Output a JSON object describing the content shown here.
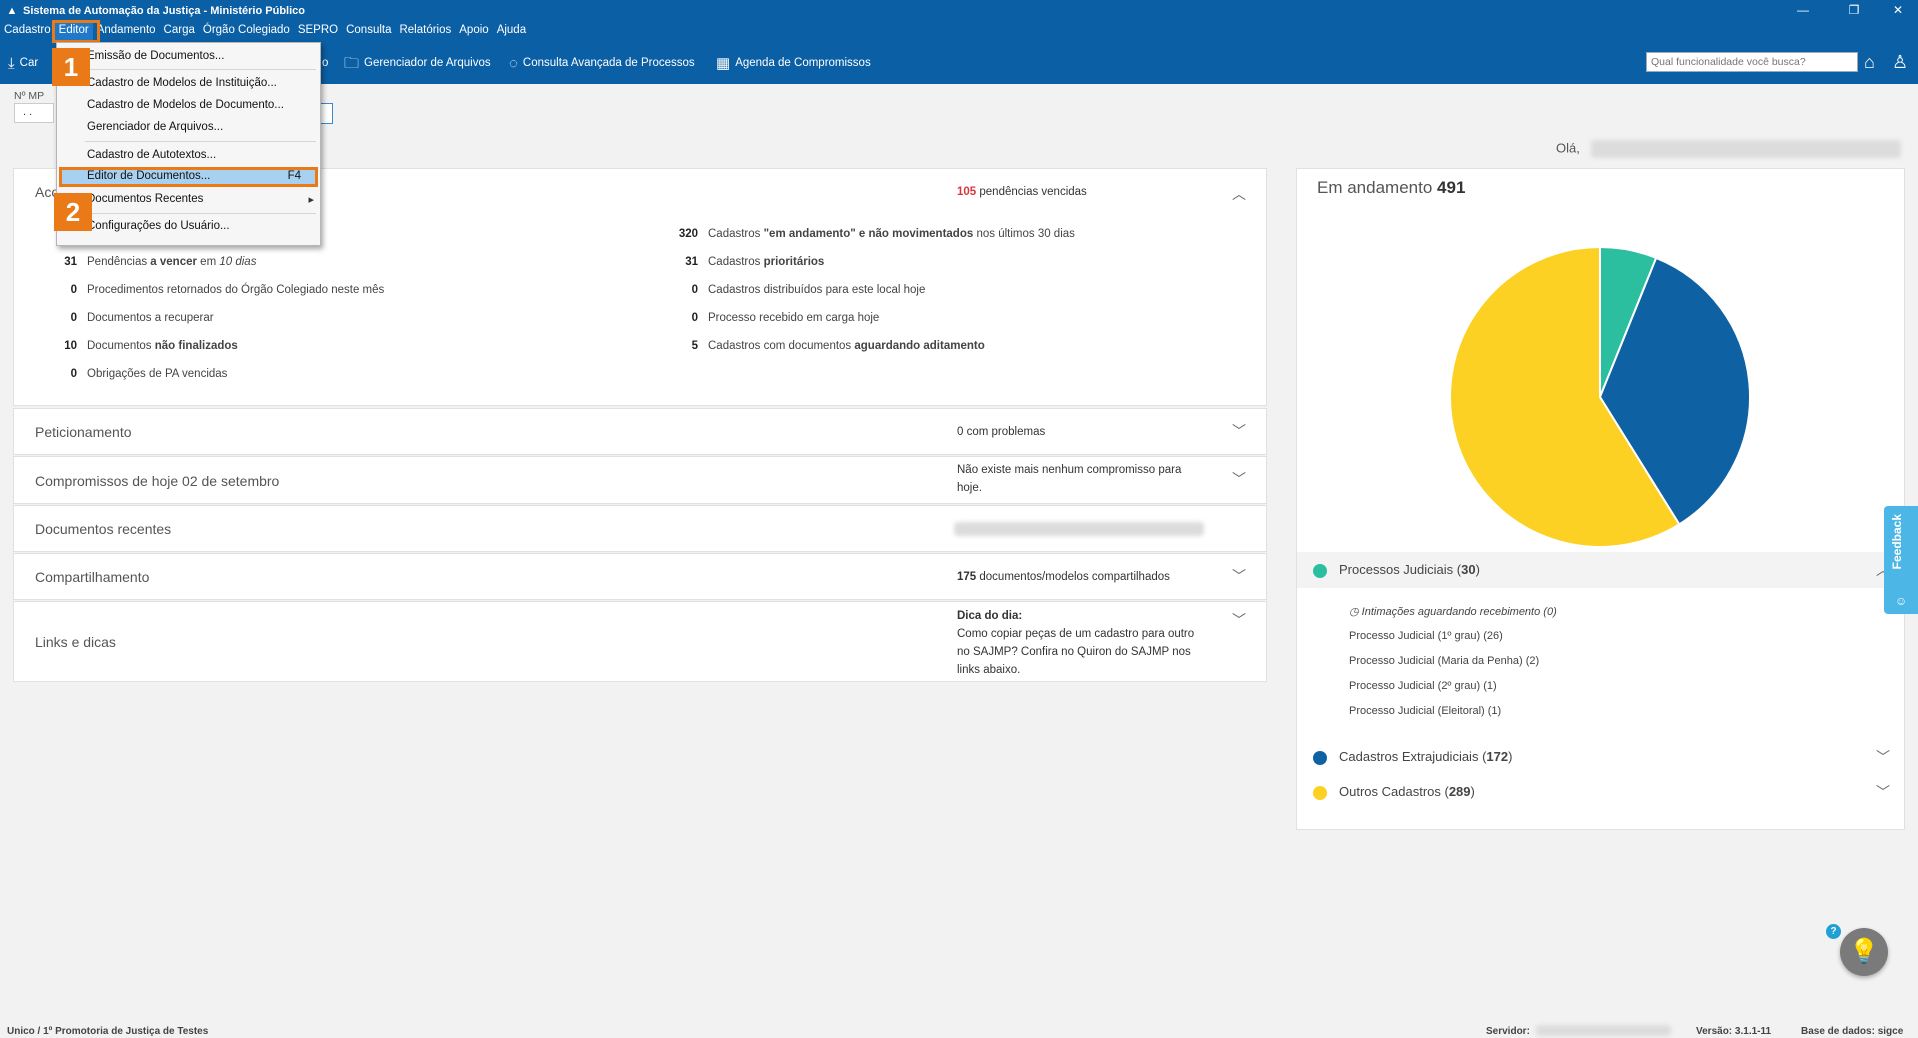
{
  "window": {
    "title": "Sistema de Automação da Justiça - Ministério Público"
  },
  "menubar": [
    "Cadastro",
    "Editor",
    "Andamento",
    "Carga",
    "Órgão Colegiado",
    "SEPRO",
    "Consulta",
    "Relatórios",
    "Apoio",
    "Ajuda"
  ],
  "toolbar": {
    "carga_label": "Car",
    "partial_label": "o",
    "gerenciador": "Gerenciador de Arquivos",
    "consulta": "Consulta Avançada de Processos",
    "agenda": "Agenda de Compromissos",
    "search_placeholder": "Qual funcionalidade você busca?"
  },
  "mp_field": {
    "label": "Nº MP",
    "value": ". ."
  },
  "greeting": "Olá,",
  "editor_menu": {
    "items": [
      "Emissão de Documentos...",
      "Cadastro de Modelos de Instituição...",
      "Cadastro de Modelos de Documento...",
      "Gerenciador de Arquivos...",
      "Cadastro de Autotextos...",
      "Editor de Documentos...",
      "Documentos Recentes",
      "Configurações do Usuário..."
    ],
    "shortcut": "F4",
    "submenu_arrow": "▸"
  },
  "annotations": {
    "step1": "1",
    "step2": "2"
  },
  "acompanhamento": {
    "title": "Acompanhamento",
    "right_num": "105",
    "right_text": "pendências vencidas",
    "left_stats": [
      {
        "num": "31",
        "pre": "Pendências ",
        "bold": "a vencer",
        "post": " em ",
        "italic": "10 dias"
      },
      {
        "num": "0",
        "text": "Procedimentos retornados do Órgão Colegiado neste mês"
      },
      {
        "num": "0",
        "text": "Documentos a recuperar"
      },
      {
        "num": "10",
        "pre": "Documentos ",
        "bold": "não finalizados"
      },
      {
        "num": "0",
        "text": "Obrigações de PA vencidas"
      }
    ],
    "right_stats": [
      {
        "num": "320",
        "pre": "Cadastros ",
        "bold": "\"em andamento\" e não movimentados",
        "post": " nos últimos 30 dias"
      },
      {
        "num": "31",
        "pre": "Cadastros ",
        "bold": "prioritários"
      },
      {
        "num": "0",
        "text": "Cadastros distribuídos para este local hoje"
      },
      {
        "num": "0",
        "text": "Processo recebido em carga hoje"
      },
      {
        "num": "5",
        "pre": "Cadastros com documentos ",
        "bold": "aguardando aditamento"
      }
    ]
  },
  "panels": {
    "peticionamento": {
      "title": "Peticionamento",
      "num": "0",
      "text": "com problemas"
    },
    "compromissos": {
      "title": "Compromissos de hoje 02 de setembro",
      "text": "Não existe mais nenhum compromisso para hoje."
    },
    "documentos": {
      "title": "Documentos recentes"
    },
    "compartilhamento": {
      "title": "Compartilhamento",
      "num": "175",
      "text": "documentos/modelos compartilhados"
    },
    "links": {
      "title": "Links e dicas",
      "tip_title": "Dica do dia:",
      "tip_text": "Como copiar peças de um cadastro para outro no SAJMP? Confira no Quiron do SAJMP nos links abaixo."
    }
  },
  "card": {
    "title": "Em andamento",
    "total": "491",
    "legend": [
      {
        "label": "Processos Judiciais",
        "count": "30",
        "color": "#2bbf9f"
      },
      {
        "label": "Cadastros Extrajudiciais",
        "count": "172",
        "color": "#0e62a4"
      },
      {
        "label": "Outros Cadastros",
        "count": "289",
        "color": "#fcd123"
      }
    ],
    "sub_items": [
      "Intimações aguardando recebimento (0)",
      "Processo Judicial (1º grau) (26)",
      "Processo Judicial (Maria da Penha) (2)",
      "Processo Judicial (2º grau) (1)",
      "Processo Judicial (Eleitoral) (1)"
    ]
  },
  "chart_data": {
    "type": "pie",
    "categories": [
      "Processos Judiciais",
      "Cadastros Extrajudiciais",
      "Outros Cadastros"
    ],
    "values": [
      30,
      172,
      289
    ],
    "colors": [
      "#2bbf9f",
      "#0e62a4",
      "#fcd123"
    ],
    "title": "Em andamento 491"
  },
  "feedback": "Feedback",
  "help": "?",
  "statusbar": {
    "left": "Unico / 1º Promotoria de Justiça de Testes",
    "servidor": "Servidor:",
    "versao": "Versão: 3.1.1-11",
    "base": "Base de dados: sigce"
  }
}
